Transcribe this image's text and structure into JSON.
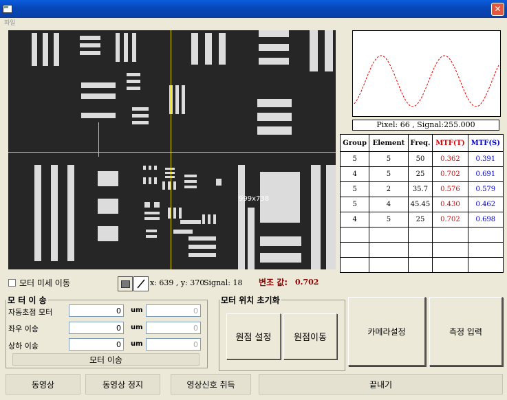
{
  "window": {
    "close_symbol": "✕"
  },
  "menu": {
    "items": [
      "파일"
    ]
  },
  "image_view": {
    "resolution_label": "999x738"
  },
  "profile": {
    "pixel_text": "Pixel:   66   ,   Signal:255.000"
  },
  "mtf_table": {
    "headers": [
      "Group",
      "Element",
      "Freq.",
      "MTF(T)",
      "MTF(S)"
    ],
    "rows": [
      [
        "5",
        "5",
        "50",
        "0.362",
        "0.391"
      ],
      [
        "4",
        "5",
        "25",
        "0.702",
        "0.691"
      ],
      [
        "5",
        "2",
        "35.7",
        "0.576",
        "0.579"
      ],
      [
        "5",
        "4",
        "45.45",
        "0.430",
        "0.462"
      ],
      [
        "4",
        "5",
        "25",
        "0.702",
        "0.698"
      ],
      [
        "",
        "",
        "",
        "",
        ""
      ],
      [
        "",
        "",
        "",
        "",
        ""
      ],
      [
        "",
        "",
        "",
        "",
        ""
      ]
    ]
  },
  "status": {
    "fine_move_label": "모터 미세 이동",
    "coords_text": "x: 639 , y: 370",
    "signal_text": "Signal: 18",
    "modulation_label": "변조 값:",
    "modulation_value": "0.702"
  },
  "motor_move": {
    "legend": "모 터 이 송",
    "rows": [
      {
        "label": "자동초점 모터",
        "value": "0",
        "unit": "um",
        "value2": "0"
      },
      {
        "label": "좌우 이송",
        "value": "0",
        "unit": "um",
        "value2": "0"
      },
      {
        "label": "상하 이송",
        "value": "0",
        "unit": "um",
        "value2": "0"
      }
    ],
    "button": "모터 이송"
  },
  "motor_init": {
    "legend": "모터 위치 초기화",
    "set_origin": "원점 설정",
    "move_origin": "원점이동"
  },
  "camera_settings": "카메라설정",
  "measure_input": "측정 입력",
  "bottom": {
    "video": "동영상",
    "video_stop": "동영상 정지",
    "signal_acquire": "영상신호 취득",
    "exit": "끝내기"
  },
  "colors": {
    "titlebar": "#0A5DDE",
    "face": "#ECE9D8",
    "mtf_t": "#E00000",
    "mtf_s": "#0000C8",
    "modulation": "#8B0000",
    "crosshair": "#E6D200",
    "profile_curve": "#E00000"
  }
}
